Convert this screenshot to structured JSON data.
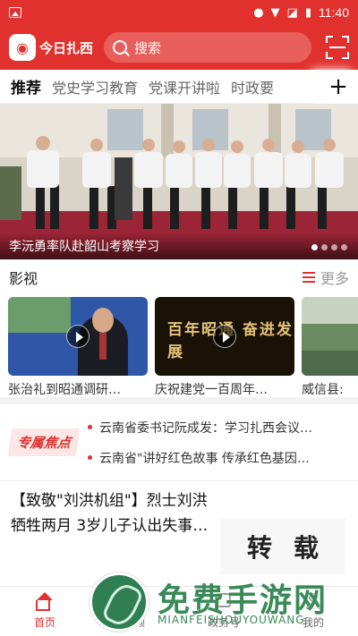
{
  "status_bar": {
    "time": "11:40"
  },
  "header": {
    "app_name": "今日扎西",
    "search_placeholder": "搜索",
    "colors": {
      "brand": "#e0312e"
    }
  },
  "tabs": [
    {
      "label": "推荐",
      "active": true
    },
    {
      "label": "党史学习教育"
    },
    {
      "label": "党课开讲啦"
    },
    {
      "label": "时政要"
    }
  ],
  "tabs_more": "+",
  "banner": {
    "caption": "李沅勇率队赴韶山考察学习",
    "page_count": 4,
    "active_page": 1
  },
  "video_section": {
    "title": "影视",
    "more_label": "更多",
    "items": [
      {
        "title": "张治礼到昭通调研…",
        "thumb_text": ""
      },
      {
        "title": "庆祝建党一百周年…",
        "thumb_text": "百年昭通 奋进发展"
      },
      {
        "title": "威信县:",
        "thumb_text": ""
      }
    ]
  },
  "focus": {
    "badge": "专属焦点",
    "items": [
      "云南省委书记阮成发：学习扎西会议…",
      "云南省\"讲好红色故事 传承红色基因…"
    ]
  },
  "news": {
    "title": "【致敬\"刘洪机组\"】烈士刘洪牺牲两月 3岁儿子认出失事…"
  },
  "float_ad": {
    "text_1": "转",
    "text_2": "载"
  },
  "bottom_nav": [
    {
      "label": "首页",
      "icon": "home-icon",
      "active": true
    },
    {
      "label": "视频",
      "icon": "video-icon"
    },
    {
      "label": "政务号",
      "icon": "gov-icon"
    },
    {
      "label": "我的",
      "icon": "person-icon"
    }
  ],
  "watermark": {
    "title": "免费手游网",
    "subtitle": "MIANFEISHOUYOUWANG"
  }
}
